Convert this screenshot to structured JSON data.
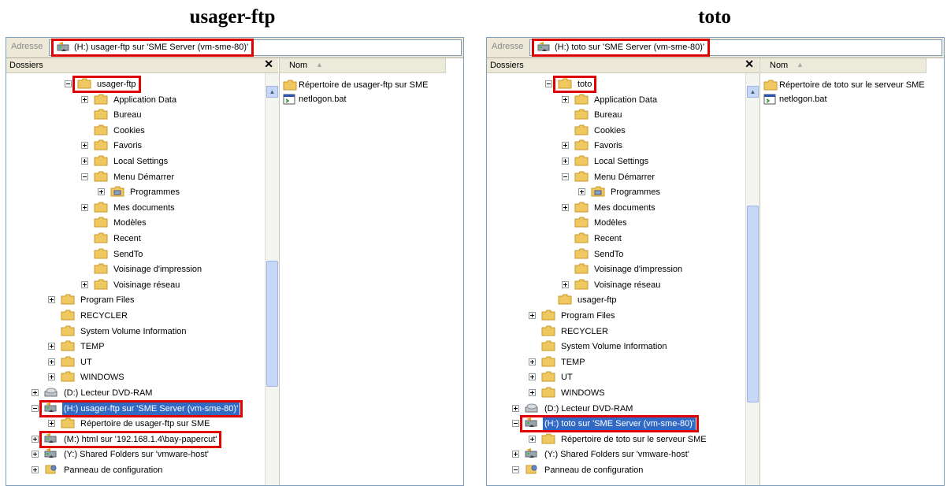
{
  "left": {
    "caption": "usager-ftp",
    "address_label": "Adresse",
    "address_value": "(H:) usager-ftp sur 'SME Server (vm-sme-80)'",
    "folders_title": "Dossiers",
    "column_name": "Nom",
    "files": [
      "Répertoire de usager-ftp sur SME",
      "netlogon.bat"
    ],
    "tree": [
      {
        "label": "usager-ftp",
        "depth": 3,
        "exp": "minus",
        "icon": "folder",
        "hl": true
      },
      {
        "label": "Application Data",
        "depth": 4,
        "exp": "plus",
        "icon": "folder"
      },
      {
        "label": "Bureau",
        "depth": 4,
        "exp": "",
        "icon": "folder"
      },
      {
        "label": "Cookies",
        "depth": 4,
        "exp": "",
        "icon": "folder"
      },
      {
        "label": "Favoris",
        "depth": 4,
        "exp": "plus",
        "icon": "folder"
      },
      {
        "label": "Local Settings",
        "depth": 4,
        "exp": "plus",
        "icon": "folder"
      },
      {
        "label": "Menu Démarrer",
        "depth": 4,
        "exp": "minus",
        "icon": "folder"
      },
      {
        "label": "Programmes",
        "depth": 5,
        "exp": "plus",
        "icon": "programs"
      },
      {
        "label": "Mes documents",
        "depth": 4,
        "exp": "plus",
        "icon": "folder"
      },
      {
        "label": "Modèles",
        "depth": 4,
        "exp": "",
        "icon": "folder"
      },
      {
        "label": "Recent",
        "depth": 4,
        "exp": "",
        "icon": "folder"
      },
      {
        "label": "SendTo",
        "depth": 4,
        "exp": "",
        "icon": "folder"
      },
      {
        "label": "Voisinage d'impression",
        "depth": 4,
        "exp": "",
        "icon": "folder"
      },
      {
        "label": "Voisinage réseau",
        "depth": 4,
        "exp": "plus",
        "icon": "folder"
      },
      {
        "label": "Program Files",
        "depth": 2,
        "exp": "plus",
        "icon": "folder"
      },
      {
        "label": "RECYCLER",
        "depth": 2,
        "exp": "",
        "icon": "folder"
      },
      {
        "label": "System Volume Information",
        "depth": 2,
        "exp": "",
        "icon": "folder"
      },
      {
        "label": "TEMP",
        "depth": 2,
        "exp": "plus",
        "icon": "folder"
      },
      {
        "label": "UT",
        "depth": 2,
        "exp": "plus",
        "icon": "folder"
      },
      {
        "label": "WINDOWS",
        "depth": 2,
        "exp": "plus",
        "icon": "folder"
      },
      {
        "label": "(D:) Lecteur DVD-RAM",
        "depth": 1,
        "exp": "plus",
        "icon": "dvd"
      },
      {
        "label": "(H:) usager-ftp sur 'SME Server (vm-sme-80)'",
        "depth": 1,
        "exp": "minus",
        "icon": "netdrive",
        "sel": true,
        "hl": true
      },
      {
        "label": "Répertoire de usager-ftp sur SME",
        "depth": 2,
        "exp": "plus",
        "icon": "folder"
      },
      {
        "label": "(M:) html sur '192.168.1.4\\bay-papercut'",
        "depth": 1,
        "exp": "plus",
        "icon": "netdrive",
        "hl": true
      },
      {
        "label": "(Y:) Shared Folders sur 'vmware-host'",
        "depth": 1,
        "exp": "plus",
        "icon": "netdrive"
      },
      {
        "label": "Panneau de configuration",
        "depth": 1,
        "exp": "plus",
        "icon": "control"
      }
    ]
  },
  "right": {
    "caption": "toto",
    "address_label": "Adresse",
    "address_value": "(H:) toto sur 'SME Server (vm-sme-80)'",
    "folders_title": "Dossiers",
    "column_name": "Nom",
    "files": [
      "Répertoire de toto sur le serveur SME",
      "netlogon.bat"
    ],
    "tree": [
      {
        "label": "toto",
        "depth": 3,
        "exp": "minus",
        "icon": "folder",
        "hl": true
      },
      {
        "label": "Application Data",
        "depth": 4,
        "exp": "plus",
        "icon": "folder"
      },
      {
        "label": "Bureau",
        "depth": 4,
        "exp": "",
        "icon": "folder"
      },
      {
        "label": "Cookies",
        "depth": 4,
        "exp": "",
        "icon": "folder"
      },
      {
        "label": "Favoris",
        "depth": 4,
        "exp": "plus",
        "icon": "folder"
      },
      {
        "label": "Local Settings",
        "depth": 4,
        "exp": "plus",
        "icon": "folder"
      },
      {
        "label": "Menu Démarrer",
        "depth": 4,
        "exp": "minus",
        "icon": "folder"
      },
      {
        "label": "Programmes",
        "depth": 5,
        "exp": "plus",
        "icon": "programs"
      },
      {
        "label": "Mes documents",
        "depth": 4,
        "exp": "plus",
        "icon": "folder"
      },
      {
        "label": "Modèles",
        "depth": 4,
        "exp": "",
        "icon": "folder"
      },
      {
        "label": "Recent",
        "depth": 4,
        "exp": "",
        "icon": "folder"
      },
      {
        "label": "SendTo",
        "depth": 4,
        "exp": "",
        "icon": "folder"
      },
      {
        "label": "Voisinage d'impression",
        "depth": 4,
        "exp": "",
        "icon": "folder"
      },
      {
        "label": "Voisinage réseau",
        "depth": 4,
        "exp": "plus",
        "icon": "folder"
      },
      {
        "label": "usager-ftp",
        "depth": 3,
        "exp": "",
        "icon": "folder"
      },
      {
        "label": "Program Files",
        "depth": 2,
        "exp": "plus",
        "icon": "folder"
      },
      {
        "label": "RECYCLER",
        "depth": 2,
        "exp": "",
        "icon": "folder"
      },
      {
        "label": "System Volume Information",
        "depth": 2,
        "exp": "",
        "icon": "folder"
      },
      {
        "label": "TEMP",
        "depth": 2,
        "exp": "plus",
        "icon": "folder"
      },
      {
        "label": "UT",
        "depth": 2,
        "exp": "plus",
        "icon": "folder"
      },
      {
        "label": "WINDOWS",
        "depth": 2,
        "exp": "plus",
        "icon": "folder"
      },
      {
        "label": "(D:) Lecteur DVD-RAM",
        "depth": 1,
        "exp": "plus",
        "icon": "dvd"
      },
      {
        "label": "(H:) toto sur 'SME Server (vm-sme-80)'",
        "depth": 1,
        "exp": "minus",
        "icon": "netdrive",
        "sel": true,
        "hl": true
      },
      {
        "label": "Répertoire de toto sur le serveur SME",
        "depth": 2,
        "exp": "plus",
        "icon": "folder"
      },
      {
        "label": "(Y:) Shared Folders sur 'vmware-host'",
        "depth": 1,
        "exp": "plus",
        "icon": "netdrive"
      },
      {
        "label": "Panneau de configuration",
        "depth": 1,
        "exp": "minus",
        "icon": "control"
      }
    ]
  },
  "colors": {
    "highlight": "#e00000",
    "selection": "#316ac5",
    "folder": "#f0c862"
  }
}
